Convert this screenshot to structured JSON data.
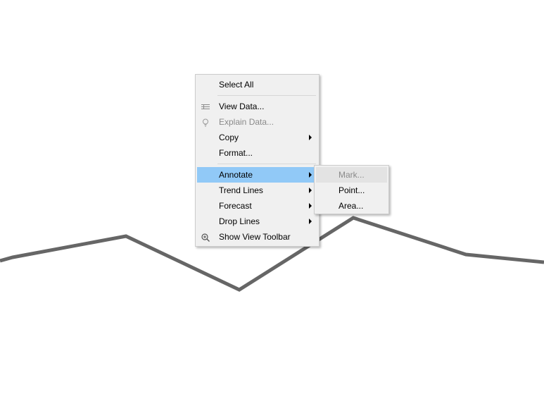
{
  "chart": {
    "line_color": "#666666",
    "background": "#ffffff"
  },
  "context_menu": {
    "items": [
      {
        "label": "Select All",
        "enabled": true,
        "has_submenu": false
      },
      {
        "label": "View Data...",
        "enabled": true,
        "has_submenu": false,
        "icon": "table-icon"
      },
      {
        "label": "Explain Data...",
        "enabled": false,
        "has_submenu": false,
        "icon": "lightbulb-icon"
      },
      {
        "label": "Copy",
        "enabled": true,
        "has_submenu": true
      },
      {
        "label": "Format...",
        "enabled": true,
        "has_submenu": false
      },
      {
        "label": "Annotate",
        "enabled": true,
        "has_submenu": true,
        "highlighted": true
      },
      {
        "label": "Trend Lines",
        "enabled": true,
        "has_submenu": true
      },
      {
        "label": "Forecast",
        "enabled": true,
        "has_submenu": true
      },
      {
        "label": "Drop Lines",
        "enabled": true,
        "has_submenu": true
      },
      {
        "label": "Show View Toolbar",
        "enabled": true,
        "has_submenu": false,
        "icon": "zoom-icon"
      }
    ]
  },
  "annotate_submenu": {
    "items": [
      {
        "label": "Mark...",
        "enabled": false
      },
      {
        "label": "Point...",
        "enabled": true
      },
      {
        "label": "Area...",
        "enabled": true
      }
    ]
  },
  "colors": {
    "highlight": "#91c9f7",
    "menu_bg": "#f0f0f0",
    "disabled_text": "#8a8a8a"
  }
}
